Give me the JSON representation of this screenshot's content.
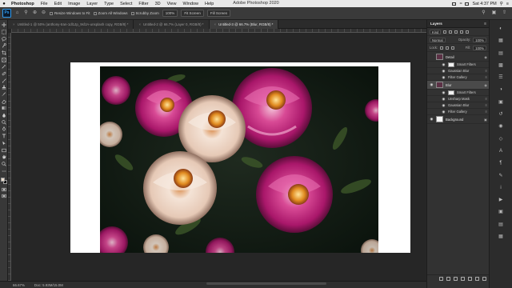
{
  "menubar": {
    "apple": "",
    "app": "Photoshop",
    "items": [
      "File",
      "Edit",
      "Image",
      "Layer",
      "Type",
      "Select",
      "Filter",
      "3D",
      "View",
      "Window",
      "Help"
    ],
    "title": "Adobe Photoshop 2020",
    "clock": "Sat 4:37 PM"
  },
  "options": {
    "resize_windows": "Resize Windows to Fit",
    "zoom_all": "Zoom All Windows",
    "scrubby": "Scrubby Zoom",
    "zoom_pct": "100%",
    "fit_screen": "Fit Screen",
    "fill_screen": "Fill Screen"
  },
  "tabs": [
    {
      "label": "Untitled-1 @ 50% (anthony-tran-1dl1Jp_9sfJA-unsplash copy, RGB/8) *"
    },
    {
      "label": "Untitled-2 @ 66.7% (Layer 0, RGB/8) *"
    },
    {
      "label": "Untitled-3 @ 66.7% (Blur, RGB/8) *"
    }
  ],
  "status": {
    "zoom": "66.67%",
    "doc": "Doc: 5.93M/15.0M"
  },
  "layers_panel": {
    "tab": "Layers",
    "kind": "Kind",
    "blend": "Normal",
    "opacity_label": "Opacity:",
    "opacity": "100%",
    "lock_label": "Lock:",
    "fill_label": "Fill:",
    "fill": "100%",
    "layers": [
      {
        "name": "Detail",
        "kind": "main"
      },
      {
        "name": "Smart Filters",
        "kind": "filter"
      },
      {
        "name": "Gaussian Blur",
        "kind": "filter"
      },
      {
        "name": "Filter Gallery",
        "kind": "filter"
      },
      {
        "name": "Blur",
        "kind": "main"
      },
      {
        "name": "Smart Filters",
        "kind": "filter"
      },
      {
        "name": "Unsharp Mask",
        "kind": "filter"
      },
      {
        "name": "Gaussian Blur",
        "kind": "filter"
      },
      {
        "name": "Filter Gallery",
        "kind": "filter"
      },
      {
        "name": "Background",
        "kind": "main"
      }
    ]
  },
  "colors": {
    "foreground": "#eadccc",
    "background": "#111111",
    "accent": "#2e9bf0"
  }
}
